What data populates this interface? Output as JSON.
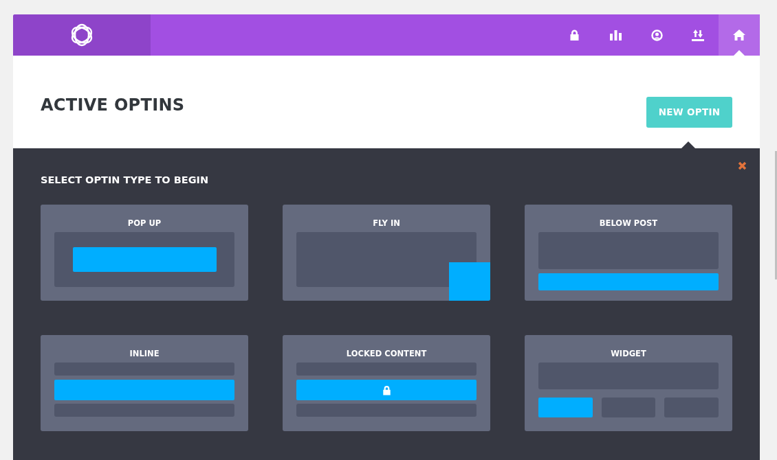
{
  "header": {
    "nav": [
      {
        "kind": "lock",
        "selected": false
      },
      {
        "kind": "stats",
        "selected": false
      },
      {
        "kind": "account",
        "selected": false
      },
      {
        "kind": "import",
        "selected": false
      },
      {
        "kind": "home",
        "selected": true
      }
    ]
  },
  "title": "ACTIVE OPTINS",
  "new_button": "NEW OPTIN",
  "picker": {
    "heading": "SELECT OPTIN TYPE TO BEGIN",
    "types": [
      {
        "kind": "popup",
        "label": "POP UP"
      },
      {
        "kind": "flyin",
        "label": "FLY IN"
      },
      {
        "kind": "below_post",
        "label": "BELOW POST"
      },
      {
        "kind": "inline",
        "label": "INLINE"
      },
      {
        "kind": "locked",
        "label": "LOCKED CONTENT"
      },
      {
        "kind": "widget",
        "label": "WIDGET"
      }
    ]
  }
}
